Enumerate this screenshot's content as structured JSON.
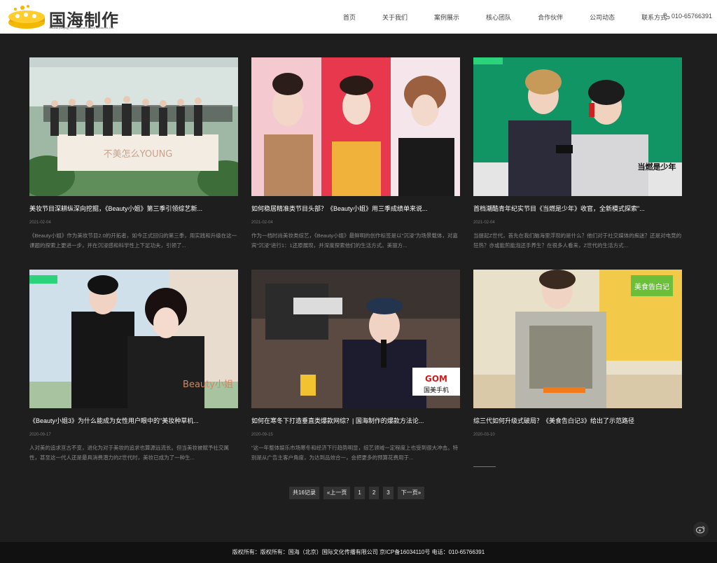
{
  "brand": {
    "name": "国海制作",
    "subtitle": "Guohai (Beijing) International Culture Media Co.,Ltd."
  },
  "nav": [
    "首页",
    "关于我们",
    "案例展示",
    "核心团队",
    "合作伙伴",
    "公司动态",
    "联系方式"
  ],
  "phone": "010-65766391",
  "cards": [
    {
      "title": "美妆节目深耕纵深向挖掘，《Beauty小姐》第三季引领综艺新...",
      "date": "2021-02-04",
      "desc": "《Beauty小姐》作为美妆节目2.0的开拓者，如今正式回归的第三季，用实践和升级在这一课题的探索上更进一步，并在沉浸感和科学性上下足功夫，引领了...",
      "overlay": "不美怎么YOUNG"
    },
    {
      "title": "如何稳居精准类节目头部？《Beauty小姐》用三季成绩单来说...",
      "date": "2021-02-04",
      "desc": "作为一档时尚美妆类综艺，《Beauty小姐》最鲜明的创作标签是以\"沉浸\"为场景载体，对嘉宾\"沉浸\"进行1：1还原展现，并深度探索他们的生活方式。美丽方...",
      "overlay": ""
    },
    {
      "title": "首档潮酷青年纪实节目《当燃是少年》收官，全新模式探索\"...",
      "date": "2021-02-04",
      "desc": "当提起Z世代，首先在我们脑海里浮现的是什么？他们对于社交媒体的痴迷？还是对电竞的狂热？亦或能煎能泡还手养生？在很多人看来，Z世代的生活方式...",
      "overlay": "当燃是少年"
    },
    {
      "title": "《Beauty小姐3》为什么能成为女性用户眼中的\"美妆种草机...",
      "date": "2020-09-17",
      "desc": "人对美的追求亘古不变，进化为对于美妆的追求也算源远流长。但当美妆被赋予社交属性，甚至这一代人还是最具消费潜力的Z世代时，美妆已成为了一种生...",
      "overlay": "Beauty小姐"
    },
    {
      "title": "如何在寒冬下打造垂直类爆款网综？| 国海制作的爆款方法论...",
      "date": "2020-09-15",
      "desc": "\"这一年整体娱乐市场寒冬和经济下行趋势明显，综艺领域一定程度上也受到很大冲击。特别是从广告主客户角度，为达到品效合一，会把更多的预算花费用于...",
      "overlay": "GOM 国美手机"
    },
    {
      "title": "综三代如何升级式破局？《美食告白记3》给出了示范路径",
      "date": "2020-03-10",
      "desc": "",
      "overlay": "美食告白记"
    }
  ],
  "pagination": {
    "total": "共16记录",
    "prev": "«上一页",
    "pages": [
      "1",
      "2",
      "3"
    ],
    "next": "下一页»"
  },
  "footer": "版权所有：版权所有：国海（北京）国际文化传播有限公司 京ICP备16034110号 电话：010-65766391",
  "colors": {
    "background": "#1e1e1e",
    "header": "#ffffff",
    "footer": "#111111",
    "accent": "#f5b800"
  }
}
